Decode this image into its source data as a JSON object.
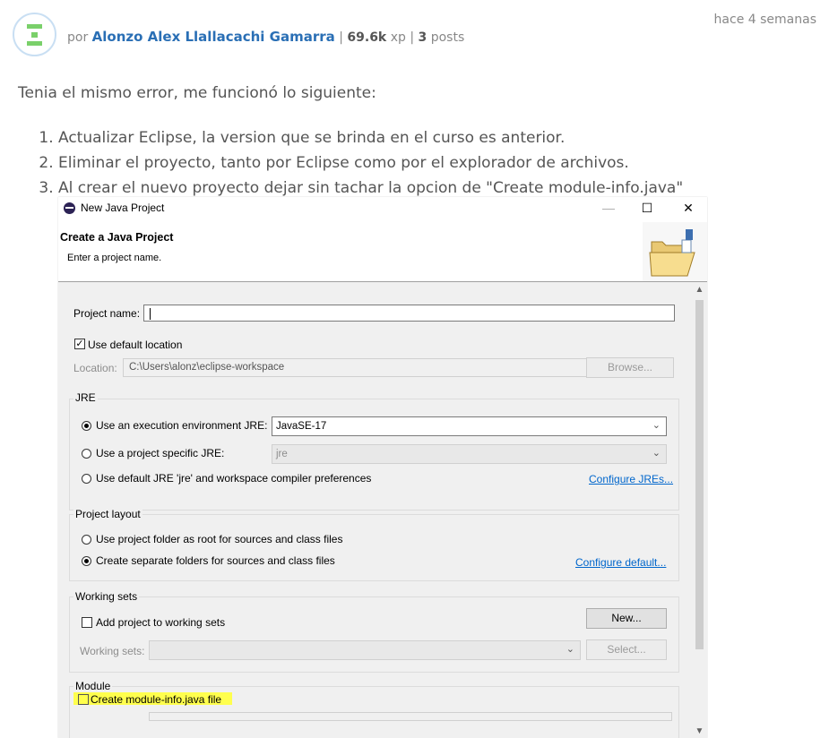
{
  "post": {
    "by_prefix": "por",
    "author": "Alonzo Alex Llallacachi Gamarra",
    "separator": "|",
    "xp_value": "69.6k",
    "xp_label": "xp",
    "posts_count": "3",
    "posts_label": "posts",
    "time_ago": "hace 4 semanas",
    "intro": "Tenia el mismo error, me funcionó lo siguiente:",
    "steps": [
      "Actualizar Eclipse, la version que se brinda en el curso es anterior.",
      "Eliminar el proyecto, tanto por Eclipse como por el explorador de archivos.",
      "Al crear el nuevo proyecto dejar sin tachar la opcion de \"Create module-info.java\""
    ]
  },
  "dialog": {
    "window_title": "New Java Project",
    "controls": {
      "minimize": "—",
      "maximize": "☐",
      "close": "✕"
    },
    "header_title": "Create a Java Project",
    "header_subtitle": "Enter a project name.",
    "project_name_label": "Project name:",
    "project_name_value": "",
    "use_default_location_label": "Use default location",
    "use_default_location_checked": true,
    "location_label": "Location:",
    "location_value": "C:\\Users\\alonz\\eclipse-workspace",
    "browse_button": "Browse...",
    "jre": {
      "group_title": "JRE",
      "option_exec_env": "Use an execution environment JRE:",
      "exec_env_value": "JavaSE-17",
      "option_project_specific": "Use a project specific JRE:",
      "project_specific_value": "jre",
      "option_default": "Use default JRE 'jre' and workspace compiler preferences",
      "configure_link": "Configure JREs...",
      "selected": "exec_env"
    },
    "layout": {
      "group_title": "Project layout",
      "option_root": "Use project folder as root for sources and class files",
      "option_separate": "Create separate folders for sources and class files",
      "configure_link": "Configure default...",
      "selected": "separate"
    },
    "working_sets": {
      "group_title": "Working sets",
      "add_label": "Add project to working sets",
      "add_checked": false,
      "new_button": "New...",
      "sets_label": "Working sets:",
      "select_button": "Select..."
    },
    "module": {
      "group_title": "Module",
      "create_label": "Create module-info.java file",
      "create_checked": false,
      "highlight_color": "#ffff4d"
    },
    "scroll": {
      "up": "▲",
      "down": "▼"
    },
    "combo_arrow": "⌄"
  }
}
